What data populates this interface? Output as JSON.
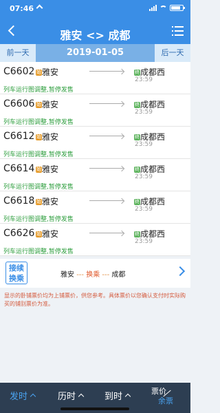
{
  "status_bar": {
    "time": "07:46"
  },
  "header": {
    "title": "雅安 <> 成都"
  },
  "date_bar": {
    "prev_label": "前一天",
    "date": "2019-01-05",
    "next_label": "后一天"
  },
  "trains": [
    {
      "number": "C6602",
      "from": "雅安",
      "to": "成都西",
      "arrival": "23:59",
      "notice": "列车运行图调整,暂停发售"
    },
    {
      "number": "C6606",
      "from": "雅安",
      "to": "成都西",
      "arrival": "23:59",
      "notice": "列车运行图调整,暂停发售"
    },
    {
      "number": "C6612",
      "from": "雅安",
      "to": "成都西",
      "arrival": "23:59",
      "notice": "列车运行图调整,暂停发售"
    },
    {
      "number": "C6614",
      "from": "雅安",
      "to": "成都西",
      "arrival": "23:59",
      "notice": "列车运行图调整,暂停发售"
    },
    {
      "number": "C6618",
      "from": "雅安",
      "to": "成都西",
      "arrival": "23:59",
      "notice": "列车运行图调整,暂停发售"
    },
    {
      "number": "C6626",
      "from": "雅安",
      "to": "成都西",
      "arrival": "23:59",
      "notice": "列车运行图调整,暂停发售"
    }
  ],
  "badges": {
    "start": "始",
    "end": "终"
  },
  "transfer": {
    "button_line1": "接续",
    "button_line2": "换乘",
    "from": "雅安",
    "dash": "---",
    "via": "换乘",
    "to": "成都"
  },
  "disclaimer": "显示的卧铺票价均为上铺票价，供您参考。具体票价以您确认支付时实际购买的铺别票价为准。",
  "bottom_tabs": {
    "departure": "发时",
    "duration": "历时",
    "arrival": "到时",
    "price": "票价",
    "remaining": "余票"
  },
  "colors": {
    "header_bg": "#3a8ee6",
    "notice_green": "#2e9e3e",
    "bottom_bg": "#2d3e52",
    "active_tab": "#4aa3f0"
  }
}
